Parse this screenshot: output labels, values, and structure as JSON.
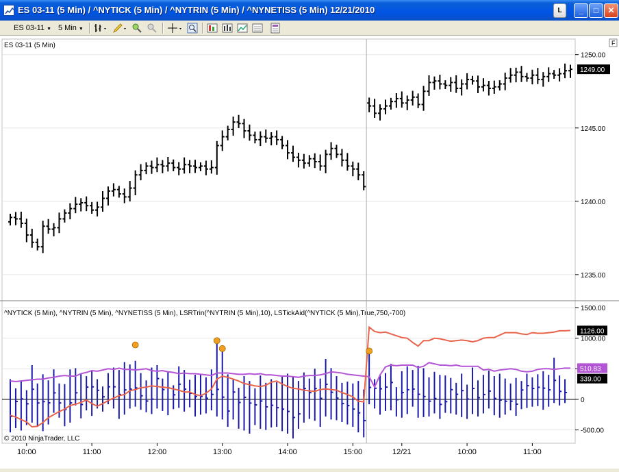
{
  "window": {
    "title": "ES 03-11 (5 Min) / ^NYTICK (5 Min) / ^NYTRIN (5 Min) / ^NYNETISS (5 Min)  12/21/2010",
    "button_L": "L",
    "button_min": "_",
    "button_max": "□",
    "button_close": "✕"
  },
  "toolbar": {
    "instrument": "ES 03-11",
    "interval": "5 Min",
    "icons": [
      "bar-type-icon",
      "pencil-draw-icon",
      "zoom-in-icon",
      "zoom-out-icon",
      "crosshair-icon",
      "magnify-icon",
      "strategies-icon",
      "indicators-icon",
      "chart-properties-icon",
      "templates-icon"
    ]
  },
  "price_panel": {
    "label": "ES 03-11 (5 Min)",
    "f_button": "F",
    "price_badge": "1249.00",
    "badge_color": "#000000"
  },
  "indicator_panel": {
    "label": "^NYTICK (5 Min), ^NYTRIN (5 Min), ^NYNETISS (5 Min), LSRTrin(^NYTRIN (5 Min),10), LSTickAid(^NYTICK (5 Min),True,750,-700)",
    "badges": [
      {
        "text": "1126.00",
        "color": "#000000",
        "value": 1126
      },
      {
        "text": "510.83",
        "color": "#b455d6",
        "value": 510.83
      },
      {
        "text": "339.00",
        "color": "#000000",
        "value": 339
      }
    ],
    "copyright": "© 2010 NinjaTrader, LLC"
  },
  "chart_data": [
    {
      "type": "ohlc",
      "name": "ES 03-11 (5 Min)",
      "y_ticks": [
        "1250.00",
        "1245.00",
        "1240.00",
        "1235.00"
      ],
      "y_tick_values": [
        1250,
        1245,
        1240,
        1235
      ],
      "ylim": [
        1233.5,
        1250.5
      ],
      "closes": [
        1238.9,
        1238.8,
        1238.5,
        1237.7,
        1237.2,
        1236.9,
        1238.3,
        1238.1,
        1238.2,
        1238.8,
        1239.2,
        1239.5,
        1239.8,
        1239.9,
        1239.7,
        1239.4,
        1239.6,
        1240.2,
        1240.7,
        1240.8,
        1240.5,
        1240.3,
        1240.9,
        1241.8,
        1242.1,
        1242.4,
        1242.3,
        1242.5,
        1242.4,
        1242.6,
        1242.3,
        1242.2,
        1242.5,
        1242.4,
        1242.3,
        1242.4,
        1242.2,
        1242.3,
        1243.8,
        1244.4,
        1244.9,
        1245.4,
        1245.3,
        1244.8,
        1244.5,
        1244.2,
        1244.4,
        1244.3,
        1244.4,
        1244.2,
        1243.8,
        1243.3,
        1243.0,
        1242.8,
        1242.6,
        1242.9,
        1242.7,
        1242.4,
        1243.2,
        1243.6,
        1243.2,
        1242.8,
        1242.4,
        1242.2,
        1241.8,
        1241.0,
        1246.5,
        1246.0,
        1246.3,
        1246.5,
        1246.8,
        1247.0,
        1246.7,
        1246.9,
        1247.1,
        1246.6,
        1247.5,
        1248.1,
        1248.2,
        1248.0,
        1247.9,
        1248.1,
        1247.7,
        1248.0,
        1248.3,
        1248.2,
        1247.8,
        1247.9,
        1247.7,
        1247.8,
        1248.0,
        1248.4,
        1248.6,
        1248.8,
        1248.5,
        1248.4,
        1248.6,
        1248.3,
        1248.5,
        1248.7,
        1248.6,
        1248.7,
        1248.9,
        1249.0
      ]
    },
    {
      "type": "indicator",
      "name": "^NYTICK / ^NYTRIN / ^NYNETISS",
      "y_ticks": [
        "1500.00",
        "1000.00",
        "500.00",
        "0",
        "-500.00"
      ],
      "y_tick_values": [
        1500,
        1000,
        500,
        0,
        -500
      ],
      "ylim": [
        -650,
        1500
      ],
      "tick_bars": [
        [
          330,
          -540
        ],
        [
          180,
          -470
        ],
        [
          300,
          -510
        ],
        [
          150,
          -420
        ],
        [
          560,
          -380
        ],
        [
          260,
          -450
        ],
        [
          410,
          -520
        ],
        [
          310,
          -410
        ],
        [
          490,
          -220
        ],
        [
          260,
          -300
        ],
        [
          250,
          -440
        ],
        [
          490,
          -380
        ],
        [
          510,
          -100
        ],
        [
          420,
          -310
        ],
        [
          380,
          -180
        ],
        [
          460,
          -270
        ],
        [
          330,
          -150
        ],
        [
          210,
          -200
        ],
        [
          430,
          -80
        ],
        [
          520,
          -150
        ],
        [
          480,
          -320
        ],
        [
          610,
          -250
        ],
        [
          570,
          -150
        ],
        [
          630,
          -120
        ],
        [
          430,
          -170
        ],
        [
          310,
          -210
        ],
        [
          520,
          -240
        ],
        [
          560,
          -150
        ],
        [
          340,
          -190
        ],
        [
          450,
          -260
        ],
        [
          230,
          -160
        ],
        [
          540,
          -140
        ],
        [
          480,
          -200
        ],
        [
          320,
          -130
        ],
        [
          400,
          -280
        ],
        [
          410,
          -250
        ],
        [
          360,
          -230
        ],
        [
          490,
          -180
        ],
        [
          950,
          -280
        ],
        [
          780,
          -330
        ],
        [
          410,
          -450
        ],
        [
          340,
          -330
        ],
        [
          190,
          -480
        ],
        [
          380,
          -510
        ],
        [
          300,
          -560
        ],
        [
          180,
          -420
        ],
        [
          390,
          -480
        ],
        [
          270,
          -500
        ],
        [
          330,
          -460
        ],
        [
          280,
          -450
        ],
        [
          380,
          -520
        ],
        [
          420,
          -560
        ],
        [
          370,
          -640
        ],
        [
          300,
          -480
        ],
        [
          440,
          -380
        ],
        [
          340,
          -320
        ],
        [
          500,
          -350
        ],
        [
          340,
          -450
        ],
        [
          660,
          -280
        ],
        [
          510,
          -330
        ],
        [
          380,
          -340
        ],
        [
          270,
          -370
        ],
        [
          290,
          -410
        ],
        [
          260,
          -450
        ],
        [
          300,
          -540
        ],
        [
          160,
          -620
        ],
        [
          780,
          -80
        ],
        [
          330,
          -150
        ],
        [
          390,
          -250
        ],
        [
          430,
          -190
        ],
        [
          580,
          -180
        ],
        [
          200,
          -280
        ],
        [
          460,
          -300
        ],
        [
          540,
          -240
        ],
        [
          480,
          -120
        ],
        [
          550,
          -300
        ],
        [
          510,
          -290
        ],
        [
          360,
          -280
        ],
        [
          450,
          -230
        ],
        [
          400,
          -320
        ],
        [
          390,
          -220
        ],
        [
          350,
          -230
        ],
        [
          270,
          -250
        ],
        [
          420,
          -290
        ],
        [
          240,
          -320
        ],
        [
          520,
          -240
        ],
        [
          310,
          -280
        ],
        [
          400,
          -230
        ],
        [
          470,
          -150
        ],
        [
          380,
          -260
        ],
        [
          420,
          -300
        ],
        [
          340,
          -250
        ],
        [
          260,
          -180
        ],
        [
          350,
          -270
        ],
        [
          300,
          -160
        ],
        [
          420,
          -140
        ],
        [
          360,
          -120
        ],
        [
          410,
          -110
        ],
        [
          460,
          -170
        ],
        [
          400,
          -120
        ],
        [
          680,
          -60
        ],
        [
          390,
          -100
        ],
        [
          330,
          -60
        ]
      ],
      "nyse_trin_line": [
        -260,
        -290,
        -330,
        -370,
        -450,
        -440,
        -380,
        -300,
        -250,
        -200,
        -160,
        -100,
        -80,
        -50,
        -10,
        -70,
        -110,
        -70,
        -20,
        20,
        60,
        80,
        140,
        160,
        190,
        200,
        220,
        210,
        200,
        190,
        170,
        150,
        120,
        120,
        80,
        60,
        100,
        170,
        330,
        380,
        360,
        330,
        300,
        260,
        240,
        220,
        210,
        230,
        280,
        300,
        250,
        210,
        180,
        170,
        150,
        140,
        130,
        160,
        170,
        160,
        150,
        110,
        80,
        40,
        -30,
        -40,
        1180,
        1110,
        1090,
        1100,
        1070,
        1040,
        1010,
        1000,
        930,
        870,
        960,
        960,
        1000,
        990,
        970,
        950,
        960,
        970,
        960,
        940,
        960,
        1000,
        1010,
        1010,
        1050,
        1090,
        1090,
        1090,
        1070,
        1060,
        1090,
        1080,
        1080,
        1090,
        1100,
        1120,
        1120,
        1126
      ],
      "lstick_line": [
        300,
        290,
        300,
        310,
        320,
        330,
        330,
        350,
        360,
        380,
        390,
        380,
        380,
        420,
        440,
        470,
        460,
        480,
        500,
        490,
        510,
        490,
        490,
        480,
        490,
        500,
        470,
        460,
        470,
        450,
        440,
        420,
        430,
        420,
        420,
        410,
        400,
        390,
        430,
        430,
        430,
        420,
        410,
        410,
        420,
        410,
        420,
        400,
        400,
        390,
        380,
        380,
        370,
        360,
        380,
        390,
        390,
        400,
        420,
        450,
        440,
        430,
        410,
        400,
        390,
        380,
        370,
        200,
        400,
        530,
        560,
        550,
        560,
        560,
        560,
        520,
        540,
        600,
        580,
        560,
        560,
        550,
        560,
        540,
        540,
        540,
        540,
        480,
        490,
        460,
        480,
        490,
        500,
        490,
        460,
        450,
        460,
        490,
        500,
        500,
        490,
        500,
        510,
        510.83
      ],
      "signal_points": [
        {
          "index": 23,
          "value": 890
        },
        {
          "index": 38,
          "value": 960
        },
        {
          "index": 39,
          "value": 830
        },
        {
          "index": 66,
          "value": 790
        }
      ]
    }
  ],
  "x_axis": {
    "labels": [
      "10:00",
      "11:00",
      "12:00",
      "13:00",
      "14:00",
      "15:00",
      "12/21",
      "10:00",
      "11:00"
    ],
    "label_index": [
      3,
      15,
      27,
      39,
      51,
      63,
      72,
      84,
      96
    ]
  },
  "session_break_index": 66,
  "colors": {
    "tick_bar": "#1a1aa8",
    "trin_line": "#e8634a",
    "lstick_line": "#b455d6",
    "signal_dot": "#f0a020",
    "price_bar": "#000000"
  }
}
